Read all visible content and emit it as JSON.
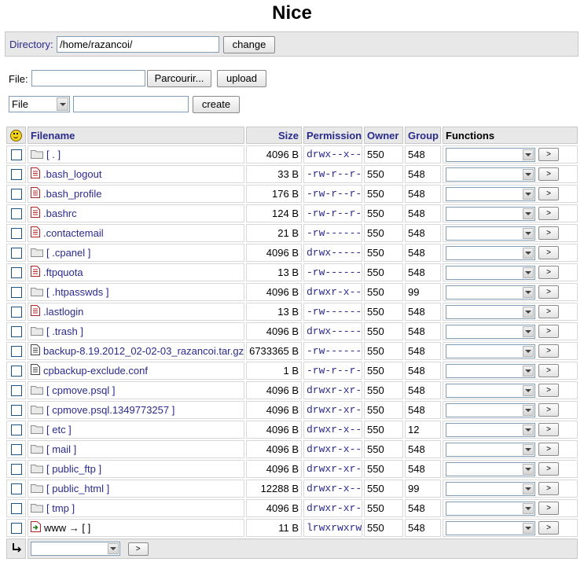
{
  "page": {
    "title": "Nice"
  },
  "directory": {
    "label": "Directory:",
    "value": "/home/razancoi/",
    "change_button": "change"
  },
  "upload": {
    "label": "File:",
    "browse_button": "Parcourir...",
    "upload_button": "upload"
  },
  "create": {
    "type_selected": "File",
    "name_value": "",
    "create_button": "create"
  },
  "columns": {
    "icon": "smiley-icon",
    "filename": "Filename",
    "size": "Size",
    "permission": "Permission",
    "owner": "Owner",
    "group": "Group",
    "functions": "Functions"
  },
  "colors": {
    "link": "#2a2a8c",
    "header_bg": "#e8e8e8",
    "file_icon": "#b22222"
  },
  "rows": [
    {
      "name": "[ . ]",
      "type": "folder",
      "size": "4096 B",
      "perm": "drwx--x--x",
      "owner": "550",
      "group": "548"
    },
    {
      "name": ".bash_logout",
      "type": "file-red",
      "size": "33 B",
      "perm": "-rw-r--r--",
      "owner": "550",
      "group": "548"
    },
    {
      "name": ".bash_profile",
      "type": "file-red",
      "size": "176 B",
      "perm": "-rw-r--r--",
      "owner": "550",
      "group": "548"
    },
    {
      "name": ".bashrc",
      "type": "file-red",
      "size": "124 B",
      "perm": "-rw-r--r--",
      "owner": "550",
      "group": "548"
    },
    {
      "name": ".contactemail",
      "type": "file-red",
      "size": "21 B",
      "perm": "-rw-------",
      "owner": "550",
      "group": "548"
    },
    {
      "name": "[ .cpanel ]",
      "type": "folder",
      "size": "4096 B",
      "perm": "drwx------",
      "owner": "550",
      "group": "548"
    },
    {
      "name": ".ftpquota",
      "type": "file-red",
      "size": "13 B",
      "perm": "-rw-------",
      "owner": "550",
      "group": "548"
    },
    {
      "name": "[ .htpasswds ]",
      "type": "folder",
      "size": "4096 B",
      "perm": "drwxr-x---",
      "owner": "550",
      "group": "99"
    },
    {
      "name": ".lastlogin",
      "type": "file-red",
      "size": "13 B",
      "perm": "-rw-------",
      "owner": "550",
      "group": "548"
    },
    {
      "name": "[ .trash ]",
      "type": "folder",
      "size": "4096 B",
      "perm": "drwx------",
      "owner": "550",
      "group": "548"
    },
    {
      "name": "backup-8.19.2012_02-02-03_razancoi.tar.gz",
      "type": "file-text",
      "size": "6733365 B",
      "perm": "-rw-------",
      "owner": "550",
      "group": "548"
    },
    {
      "name": "cpbackup-exclude.conf",
      "type": "file-text",
      "size": "1 B",
      "perm": "-rw-r--r--",
      "owner": "550",
      "group": "548"
    },
    {
      "name": "[ cpmove.psql ]",
      "type": "folder",
      "size": "4096 B",
      "perm": "drwxr-xr-x",
      "owner": "550",
      "group": "548"
    },
    {
      "name": "[ cpmove.psql.1349773257 ]",
      "type": "folder",
      "size": "4096 B",
      "perm": "drwxr-xr-x",
      "owner": "550",
      "group": "548"
    },
    {
      "name": "[ etc ]",
      "type": "folder",
      "size": "4096 B",
      "perm": "drwxr-x---",
      "owner": "550",
      "group": "12"
    },
    {
      "name": "[ mail ]",
      "type": "folder",
      "size": "4096 B",
      "perm": "drwxr-x--x",
      "owner": "550",
      "group": "548"
    },
    {
      "name": "[ public_ftp ]",
      "type": "folder",
      "size": "4096 B",
      "perm": "drwxr-xr-x",
      "owner": "550",
      "group": "548"
    },
    {
      "name": "[ public_html ]",
      "type": "folder",
      "size": "12288 B",
      "perm": "drwxr-x---",
      "owner": "550",
      "group": "99"
    },
    {
      "name": "[ tmp ]",
      "type": "folder",
      "size": "4096 B",
      "perm": "drwxr-xr-x",
      "owner": "550",
      "group": "548"
    },
    {
      "name": "www → [ ]",
      "type": "symlink",
      "size": "11 B",
      "perm": "lrwxrwxrwx",
      "owner": "550",
      "group": "548"
    }
  ],
  "row_action": {
    "go_label": ">"
  },
  "footer": {
    "arrow_icon": "return-arrow-icon",
    "bulk_select_value": "",
    "go_label": ">"
  }
}
